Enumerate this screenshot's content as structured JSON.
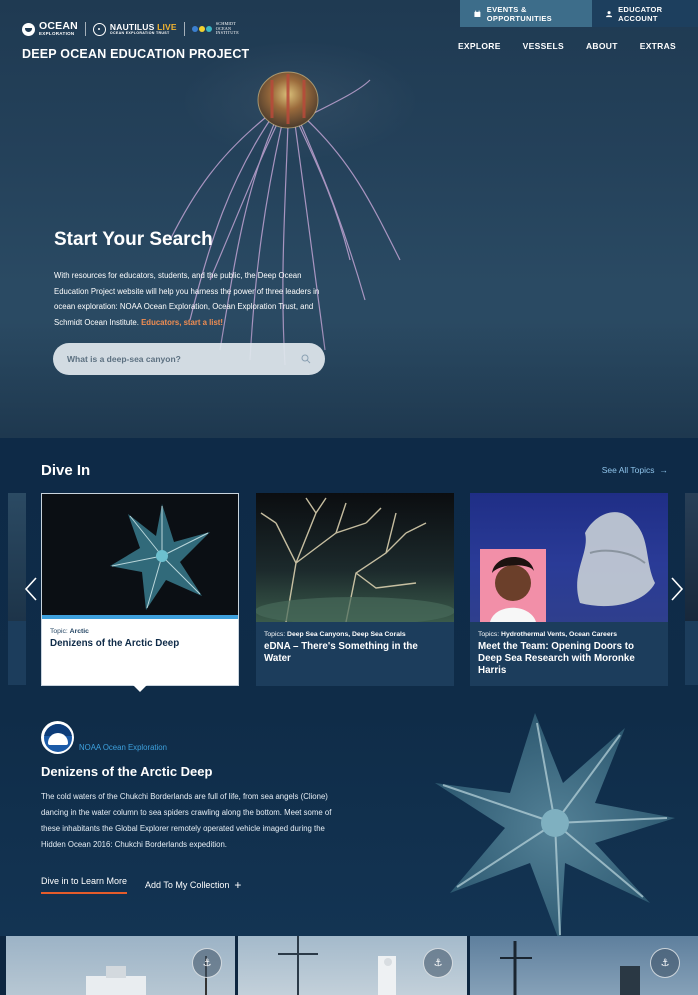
{
  "topbar": {
    "events_label": "EVENTS & OPPORTUNITIES",
    "account_label": "EDUCATOR ACCOUNT"
  },
  "logos": {
    "ocean_line1": "OCEAN",
    "ocean_line2": "EXPLORATION",
    "nautilus": "NAUTILUS",
    "nautilus_live": "LIVE",
    "nautilus_sub": "OCEAN EXPLORATION TRUST",
    "schmidt_line1": "SCHMIDT",
    "schmidt_line2": "OCEAN",
    "schmidt_line3": "INSTITUTE"
  },
  "site_title": "DEEP OCEAN EDUCATION PROJECT",
  "nav": {
    "items": [
      "EXPLORE",
      "VESSELS",
      "ABOUT",
      "EXTRAS"
    ]
  },
  "hero": {
    "title": "Start Your Search",
    "text": "With resources for educators, students, and the public, the Deep Ocean Education Project website will help you harness the power of three leaders in ocean exploration: NOAA Ocean Exploration, Ocean Exploration Trust, and Schmidt Ocean Institute. ",
    "link": "Educators, start a list!",
    "search_placeholder": "What is a deep-sea canyon?"
  },
  "dive_in": {
    "title": "Dive In",
    "see_all": "See All Topics",
    "see_all_arrow": "→",
    "cards": [
      {
        "topic_prefix": "Topic:",
        "topic": "Arctic",
        "title": "Denizens of the Arctic Deep"
      },
      {
        "topic_prefix": "Topics:",
        "topic": "Deep Sea Canyons, Deep Sea Corals",
        "title": "eDNA – There's Something in the Water"
      },
      {
        "topic_prefix": "Topics:",
        "topic": "Hydrothermal Vents, Ocean Careers",
        "title": "Meet the Team: Opening Doors to Deep Sea Research with Moronke Harris"
      }
    ]
  },
  "feature": {
    "source": "NOAA Ocean Exploration",
    "title": "Denizens of the Arctic Deep",
    "text": "The cold waters of the Chukchi Borderlands are full of life, from sea angels (Clione) dancing in the water column to sea spiders crawling along the bottom. Meet some of these inhabitants the Global Explorer remotely operated vehicle imaged during the Hidden Ocean 2016: Chukchi Borderlands expedition.",
    "learn_more": "Dive in to Learn More",
    "add_collection": "Add To My Collection",
    "add_icon": "+"
  },
  "strip": {
    "anchor_glyph": "⚓"
  },
  "colors": {
    "accent_orange": "#f08d52",
    "link_blue": "#3ea0dd",
    "navy": "#0e2a47",
    "card_blue": "#1c3d5c"
  }
}
